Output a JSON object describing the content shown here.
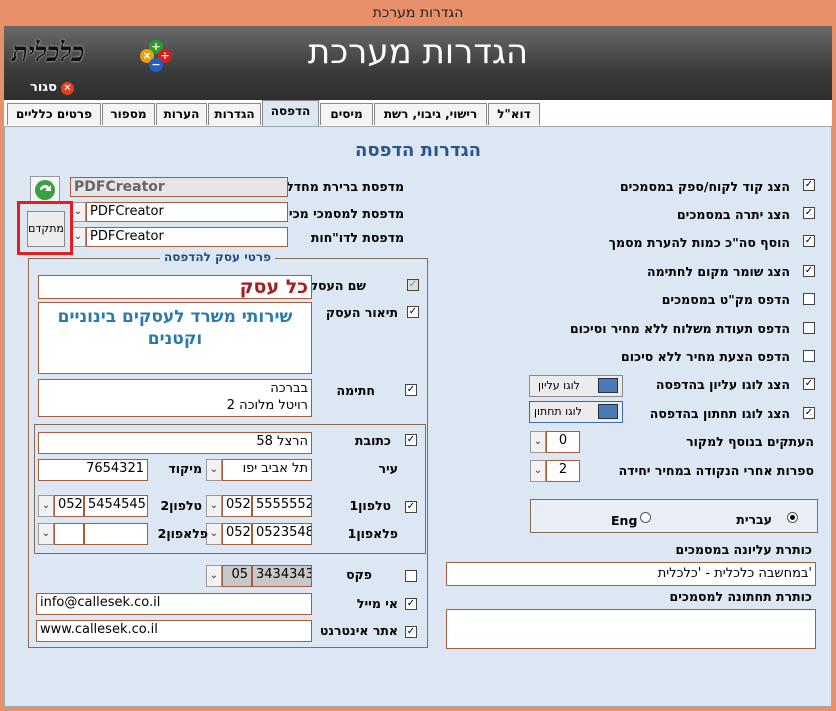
{
  "window": {
    "title": "הגדרות מערכת"
  },
  "header": {
    "title": "הגדרות מערכת",
    "logo_text": "כלכלית",
    "close_label": "סגור"
  },
  "tabs": [
    {
      "label": "דוא\"ל"
    },
    {
      "label": "רישוי, גיבוי, רשת"
    },
    {
      "label": "מיסים"
    },
    {
      "label": "הדפסה"
    },
    {
      "label": "הגדרות"
    },
    {
      "label": "הערות"
    },
    {
      "label": "מספור"
    },
    {
      "label": "פרטים כלליים"
    }
  ],
  "panel_title": "הגדרות הדפסה",
  "printers": {
    "default_label": "מדפסת ברירת מחדל",
    "default_value": "PDFCreator",
    "sales_label": "מדפסת למסמכי מכירה",
    "sales_value": "PDFCreator",
    "reports_label": "מדפסת לדו\"חות",
    "reports_value": "PDFCreator",
    "advanced_button": "מתקדם"
  },
  "business": {
    "group_label": "פרטי עסק להדפסה",
    "name_label": "שם העסק",
    "name_value": "כל עסק",
    "desc_label": "תיאור העסק",
    "desc_value": "שירותי משרד לעסקים בינוניים וקטנים",
    "sig_label": "חתימה",
    "sig_line1": "בברכה",
    "sig_line2": "רויטל מלוכה 2",
    "address_label": "כתובת",
    "address_value": "הרצל 58",
    "city_label": "עיר",
    "city_value": "תל אביב יפו",
    "zip_label": "מיקוד",
    "zip_value": "7654321",
    "phone1_label": "טלפון1",
    "phone1_num": "5555552",
    "phone1_prefix": "052",
    "phone2_label": "טלפון2",
    "phone2_num": "5454545",
    "phone2_prefix": "052",
    "cell1_label": "פלאפון1",
    "cell1_num": "0523548",
    "cell1_prefix": "052",
    "cell2_label": "פלאפון2",
    "cell2_num": "",
    "cell2_prefix": "",
    "fax_label": "פקס",
    "fax_num": "3434343",
    "fax_prefix": "05",
    "email_label": "אי מייל",
    "email_value": "info@callesek.co.il",
    "web_label": "אתר אינטרנט",
    "web_value": "www.callesek.co.il"
  },
  "options": [
    {
      "label": "הצג קוד לקוח/ספק במסמכים",
      "checked": true
    },
    {
      "label": "הצג יתרה במסמכים",
      "checked": true
    },
    {
      "label": "הוסף סה\"כ כמות להערת מסמך",
      "checked": true
    },
    {
      "label": "הצג שומר מקום לחתימה",
      "checked": true
    },
    {
      "label": "הדפס מק\"ט במסמכים",
      "checked": false
    },
    {
      "label": "הדפס תעודת משלוח ללא מחיר וסיכום",
      "checked": false
    },
    {
      "label": "הדפס הצעת מחיר ללא סיכום",
      "checked": false
    },
    {
      "label": "הצג לוגו עליון בהדפסה",
      "checked": true
    },
    {
      "label": "הצג לוגו תחתון בהדפסה",
      "checked": true
    }
  ],
  "logo_top_button": "לוגו עליון",
  "logo_bottom_button": "לוגו תחתון",
  "copies": {
    "label": "העתקים בנוסף למקור",
    "value": "0"
  },
  "decimals": {
    "label": "ספרות אחרי הנקודה במחיר יחידה",
    "value": "2"
  },
  "language": {
    "hebrew": "עברית",
    "english": "Eng"
  },
  "doc_header": {
    "label": "כותרת עליונה במסמכים",
    "value": "במחשבה כלכלית  - 'כלכלית'"
  },
  "doc_footer": {
    "label": "כותרת תחתונה למסמכים",
    "value": ""
  }
}
